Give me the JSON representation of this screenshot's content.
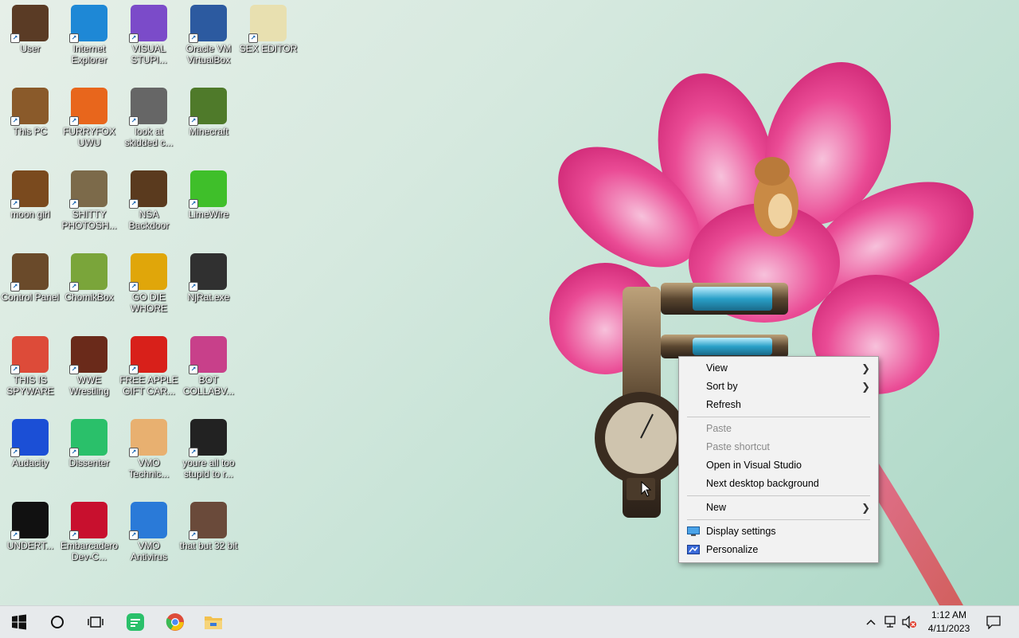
{
  "desktop": {
    "icons": [
      {
        "label": "User",
        "icon": "user-folder-icon",
        "color": "#5a3b25"
      },
      {
        "label": "Internet Explorer",
        "icon": "edge-icon",
        "color": "#1e88d6"
      },
      {
        "label": "VISUAL STUPI...",
        "icon": "visual-studio-icon",
        "color": "#7b4bc9"
      },
      {
        "label": "Oracle VM VirtualBox",
        "icon": "virtualbox-icon",
        "color": "#2c5aa0"
      },
      {
        "label": "SEX EDITOR",
        "icon": "hxd-icon",
        "color": "#e8e0b0"
      },
      {
        "label": "This PC",
        "icon": "steampunk-pc-icon",
        "color": "#8a5a2a"
      },
      {
        "label": "FURRYFOX UWU",
        "icon": "firefox-icon",
        "color": "#e8661c"
      },
      {
        "label": "look at skidded c...",
        "icon": "stacked-windows-icon",
        "color": "#666666"
      },
      {
        "label": "Minecraft",
        "icon": "minecraft-icon",
        "color": "#4f7a2a"
      },
      {
        "label": "moon girl",
        "icon": "wooden-box-icon",
        "color": "#7a4a1e"
      },
      {
        "label": "SHITTY PHOTOSH...",
        "icon": "gimp-icon",
        "color": "#7c6a4a"
      },
      {
        "label": "NSA Backdoor",
        "icon": "framed-gear-icon",
        "color": "#5a3a1e"
      },
      {
        "label": "LimeWire",
        "icon": "limewire-icon",
        "color": "#3fbf2a"
      },
      {
        "label": "Control Panel",
        "icon": "lamp-icon",
        "color": "#6a4a2a"
      },
      {
        "label": "ChomikBox",
        "icon": "chomikbox-icon",
        "color": "#7aa53a"
      },
      {
        "label": "GO DIE WHORE",
        "icon": "de-icon",
        "color": "#e0a60a"
      },
      {
        "label": "NjRat.exe",
        "icon": "skull-icon",
        "color": "#303030"
      },
      {
        "label": "THIS IS SPYWARE",
        "icon": "chrome-icon",
        "color": "#dd4b39"
      },
      {
        "label": "WWE Wrestling",
        "icon": "oven-icon",
        "color": "#6a2a1a"
      },
      {
        "label": "FREE APPLE GIFT CAR...",
        "icon": "apple-icon",
        "color": "#d8201a"
      },
      {
        "label": "BOT COLLABV...",
        "icon": "monitor-icon",
        "color": "#c8408a"
      },
      {
        "label": "Audacity",
        "icon": "audacity-icon",
        "color": "#1b4fd6"
      },
      {
        "label": "Dissenter",
        "icon": "chat-icon",
        "color": "#2ac06a"
      },
      {
        "label": "VMO Technic...",
        "icon": "doctor-icon",
        "color": "#e8b070"
      },
      {
        "label": "youre all too stupid to r...",
        "icon": "portrait-icon",
        "color": "#222222"
      },
      {
        "label": "UNDERT...",
        "icon": "unity-icon",
        "color": "#111111"
      },
      {
        "label": "Embarcadero Dev-C...",
        "icon": "devcpp-icon",
        "color": "#c8102e"
      },
      {
        "label": "VMO Antivirus",
        "icon": "shield-icon",
        "color": "#2a7ad8"
      },
      {
        "label": "that but 32 bit",
        "icon": "portrait-lady-icon",
        "color": "#6a4a3a"
      }
    ]
  },
  "context_menu": {
    "items": [
      {
        "label": "View",
        "type": "submenu",
        "disabled": false
      },
      {
        "label": "Sort by",
        "type": "submenu",
        "disabled": false
      },
      {
        "label": "Refresh",
        "type": "item",
        "disabled": false
      },
      {
        "type": "separator"
      },
      {
        "label": "Paste",
        "type": "item",
        "disabled": true
      },
      {
        "label": "Paste shortcut",
        "type": "item",
        "disabled": true
      },
      {
        "label": "Open in Visual Studio",
        "type": "item",
        "disabled": false
      },
      {
        "label": "Next desktop background",
        "type": "item",
        "disabled": false
      },
      {
        "type": "separator"
      },
      {
        "label": "New",
        "type": "submenu",
        "disabled": false
      },
      {
        "type": "separator"
      },
      {
        "label": "Display settings",
        "type": "item",
        "disabled": false,
        "icon": "display-icon"
      },
      {
        "label": "Personalize",
        "type": "item",
        "disabled": false,
        "icon": "personalize-icon"
      }
    ]
  },
  "taskbar": {
    "start_icon": "windows-logo-icon",
    "search_icon": "cortana-circle-icon",
    "task_view_icon": "task-view-icon",
    "pinned": [
      {
        "icon": "chat-icon",
        "color": "#2ac06a"
      },
      {
        "icon": "chrome-icon",
        "color": "#dd4b39"
      },
      {
        "icon": "file-explorer-icon",
        "color": "#f2c14e"
      }
    ],
    "tray": {
      "chevron_icon": "chevron-up-icon",
      "network_icon": "network-icon",
      "volume_icon": "volume-muted-icon",
      "notification_icon": "notification-icon"
    },
    "clock": {
      "time": "1:12 AM",
      "date": "4/11/2023"
    }
  },
  "colors": {
    "menu_bg": "#f2f2f2",
    "taskbar_bg": "#e7eaec",
    "flower": "#e9418f"
  }
}
